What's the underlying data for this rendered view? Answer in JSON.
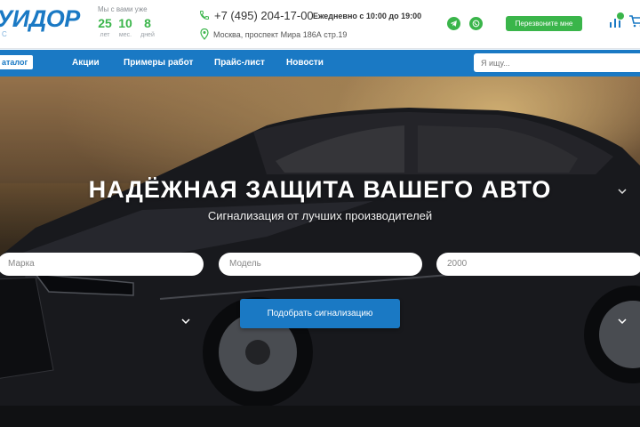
{
  "header": {
    "logo_text": "УИДОР",
    "logo_sub": "С",
    "with_us_label": "Мы с вами уже",
    "counters": [
      {
        "value": "25",
        "unit": "лет"
      },
      {
        "value": "10",
        "unit": "мес."
      },
      {
        "value": "8",
        "unit": "дней"
      }
    ],
    "phone": "+7 (495) 204-17-00",
    "hours": "Ежедневно с 10:00 до 19:00",
    "address": "Москва, проспект Мира 186А стр.19",
    "callback_label": "Перезвоните мне",
    "icons": {
      "phone": "phone-icon",
      "address": "map-pin-icon",
      "telegram": "telegram-icon",
      "whatsapp": "whatsapp-icon",
      "compare": "bar-chart-icon",
      "cart": "cart-icon"
    }
  },
  "nav": {
    "catalog_label": "аталог",
    "items": [
      "Акции",
      "Примеры работ",
      "Прайс-лист",
      "Новости"
    ],
    "search_placeholder": "Я ищу..."
  },
  "hero": {
    "title": "НАДЁЖНАЯ ЗАЩИТА ВАШЕГО АВТО",
    "subtitle": "Сигнализация от лучших производителей",
    "make_placeholder": "Марка",
    "model_placeholder": "Модель",
    "year_value": "2000",
    "submit_label": "Подобрать сигнализацию"
  },
  "colors": {
    "brand_blue": "#1a79c4",
    "accent_green": "#3ab54a"
  }
}
